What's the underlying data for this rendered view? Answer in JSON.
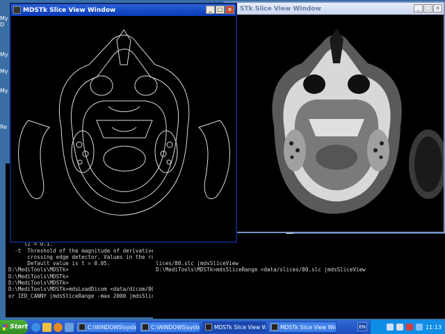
{
  "desktop": {
    "icon_labels": [
      "My D",
      "My",
      "My",
      "My",
      "Re"
    ]
  },
  "slice_window_left": {
    "title": "MDSTk Slice View Window",
    "image_style": "edge-detection (white outlines on black)"
  },
  "slice_window_right": {
    "title": "STk Slice View Window",
    "image_style": "CT slice (grayscale)"
  },
  "console_left": {
    "lines": [
      "     Default values are t1 = 0.2 and",
      "     t2 = 0.1.",
      "",
      "  -t  Threshold of the magnitude of derivatives computed by zero",
      "      crossing edge detector. Values in the range 0..1 can be given.",
      "      Default value is t = 0.05.",
      "",
      "D:\\MediTools\\MDSTk>",
      "D:\\MediTools\\MDSTk>",
      "D:\\MediTools\\MDSTk>",
      "D:\\MediTools\\MDSTk>mdsLoadDicom <data/dicom/80.dcm |mdsSliceEdgeDetector -detect",
      "or IED_CANNY |mdsSliceRange -max 2000 |mdsSliceView"
    ]
  },
  "console_right": {
    "lines": [
      "lices/80.slc |mdsSliceView",
      "",
      "",
      "",
      "D:\\MediTools\\MDSTk>mdsSliceRange <data/slices/80.slc |mdsSliceView"
    ]
  },
  "taskbar": {
    "start_label": "Start",
    "tasks": [
      {
        "label": "C:\\WINDOWS\\system32...",
        "active": false
      },
      {
        "label": "C:\\WINDOWS\\system32...",
        "active": false
      },
      {
        "label": "MDSTk Slice View Win...",
        "active": true
      },
      {
        "label": "MDSTk Slice View Window",
        "active": false
      }
    ],
    "language": "EN",
    "clock": "11:13"
  },
  "colors": {
    "desktop": "#3a6ea5",
    "title_active": "#0a3ab8",
    "taskbar": "#245edb",
    "start_button": "#3c9d2c",
    "console_text": "#d8d8d8"
  }
}
